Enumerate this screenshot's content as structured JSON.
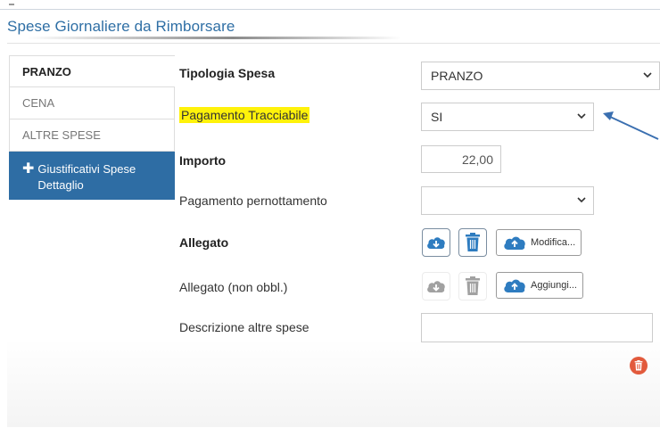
{
  "panel": {
    "title": "Spese Giornaliere da Rimborsare"
  },
  "tabs": [
    {
      "label": "PRANZO"
    },
    {
      "label": "CENA"
    },
    {
      "label": "ALTRE SPESE"
    },
    {
      "label": "Giustificativi Spese Dettaglio"
    }
  ],
  "form": {
    "tipologia": {
      "label": "Tipologia Spesa",
      "value": "PRANZO"
    },
    "pagamento_tracciabile": {
      "label": "Pagamento Tracciabile",
      "value": "SI",
      "highlight_color": "#fff20a"
    },
    "importo": {
      "label": "Importo",
      "value": "22,00"
    },
    "pagamento_pernottamento": {
      "label": "Pagamento pernottamento",
      "value": ""
    },
    "allegato": {
      "label": "Allegato",
      "upload_label": "Modifica..."
    },
    "allegato_non_obbl": {
      "label": "Allegato (non obbl.)",
      "upload_label": "Aggiungi..."
    },
    "descrizione": {
      "label": "Descrizione altre spese",
      "value": ""
    }
  },
  "colors": {
    "accent_blue": "#2e6da4",
    "title_blue": "#2f6fa5",
    "arrow_blue": "#3a6fb0",
    "delete_red": "#e25a3c"
  },
  "icons": [
    "plus-icon",
    "chevron-down-icon",
    "cloud-download-icon",
    "trash-icon",
    "cloud-upload-icon",
    "arrow-icon"
  ]
}
